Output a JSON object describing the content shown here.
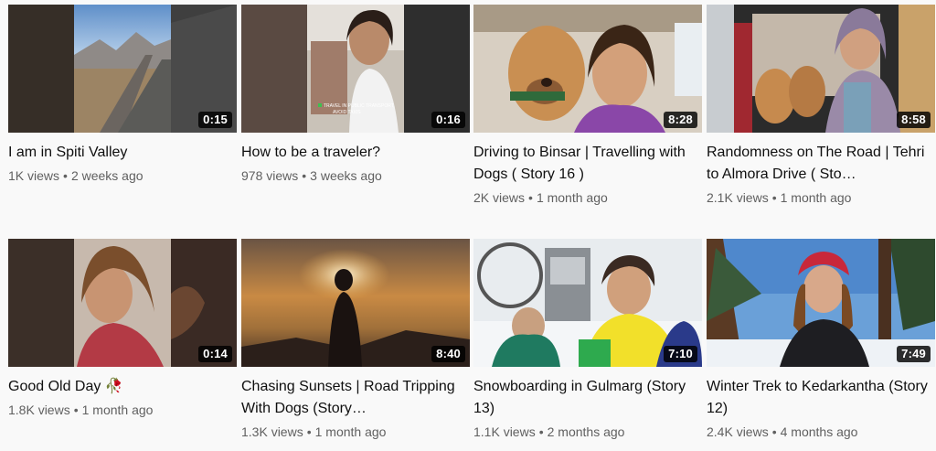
{
  "videos": [
    {
      "title": "I am in Spiti Valley",
      "duration": "0:15",
      "views": "1K views",
      "age": "2 weeks ago",
      "thumb_icon": "mountain-road-icon"
    },
    {
      "title": "How to be a traveler?",
      "duration": "0:16",
      "views": "978 views",
      "age": "3 weeks ago",
      "thumb_icon": "bus-selfie-icon",
      "thumb_caption_1": "TRAVEL IN PUBLIC TRANSPORT,",
      "thumb_caption_2": "AVOID TAXIS"
    },
    {
      "title": "Driving to Binsar | Travelling with Dogs ( Story 16 )",
      "duration": "8:28",
      "views": "2K views",
      "age": "1 month ago",
      "thumb_icon": "dog-selfie-icon"
    },
    {
      "title": "Randomness on The Road | Tehri to Almora Drive ( Sto…",
      "duration": "8:58",
      "views": "2.1K views",
      "age": "1 month ago",
      "thumb_icon": "van-dogs-icon"
    },
    {
      "title": "Good Old Day 🥀",
      "duration": "0:14",
      "views": "1.8K views",
      "age": "1 month ago",
      "thumb_icon": "portrait-icon"
    },
    {
      "title": "Chasing Sunsets | Road Tripping With Dogs (Story…",
      "duration": "8:40",
      "views": "1.3K views",
      "age": "1 month ago",
      "thumb_icon": "sunset-silhouette-icon"
    },
    {
      "title": "Snowboarding in Gulmarg (Story 13)",
      "duration": "7:10",
      "views": "1.1K views",
      "age": "2 months ago",
      "thumb_icon": "chairlift-icon"
    },
    {
      "title": "Winter Trek to Kedarkantha (Story 12)",
      "duration": "7:49",
      "views": "2.4K views",
      "age": "4 months ago",
      "thumb_icon": "snow-forest-icon"
    }
  ],
  "meta_separator": "•",
  "colors": {
    "background": "#f9f9f9",
    "title": "#0f0f0f",
    "meta": "#606060",
    "duration_bg": "#000000"
  }
}
